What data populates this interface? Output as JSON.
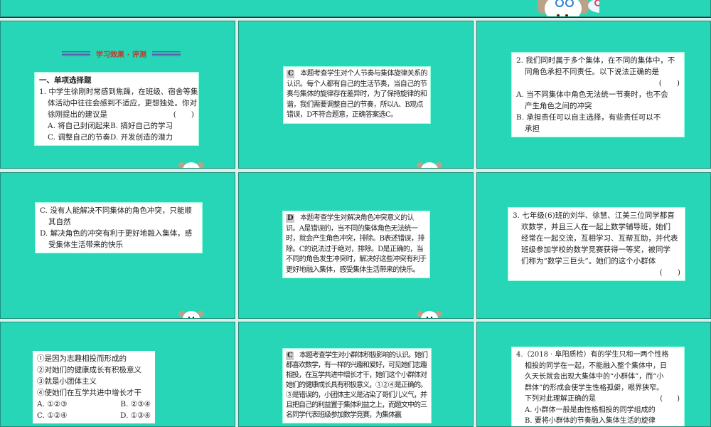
{
  "slide1": {
    "title": "学习效果 · 评测",
    "section": "一、单项选择题",
    "q1": [
      "1. 中学生徐刚时常感到焦躁，在班级、宿舍等集",
      "体活动中往往会感到不适应，更想独处。你对",
      "徐刚提出的建议是"
    ],
    "paren": "(　　)",
    "options": [
      "A. 将自己封闭起来",
      "B. 搞好自己的学习",
      "C. 调整自己的节奏",
      "D. 开发创造的潜力"
    ]
  },
  "slide2": {
    "tag": "C",
    "text": "本题考查学生对个人节奏与集体旋律关系的认识。每个人都有自己的生活节奏，当自己的节奏与集体的旋律存在差异时，为了保持旋律的和谐，我们需要调整自己的节奏，所以A、B观点错误，D不符合题意，正确答案选C。"
  },
  "slide3": {
    "q2": [
      "2. 我们同时属于多个集体，在不同的集体中，不",
      "同角色承担不同责任。以下说法正确的是"
    ],
    "paren": "(　　)",
    "optA": [
      "A. 当不同集体中角色无法统一节奏时，也不会",
      "产生角色之间的冲突"
    ],
    "optB": [
      "B. 承担责任可以自主选择，有些责任可以不",
      "承担"
    ]
  },
  "slide4": {
    "optC": [
      "C. 没有人能解决不同集体的角色冲突，只能顺",
      "其自然"
    ],
    "optD": [
      "D. 解决角色的冲突有利于更好地融入集体，感",
      "受集体生活带来的快乐"
    ]
  },
  "slide5": {
    "tag": "D",
    "text": "本题考查学生对解决角色冲突意义的认识。A是错误的，当不同的集体角色无法统一时，就会产生角色冲突，排除。B表述错误，排除。C的说法过于绝对，排除。D是正确的，当不同的角色发生冲突时，解决好这些冲突有利于更好地融入集体，感受集体生活带来的快乐。"
  },
  "slide6": {
    "q3": [
      "3. 七年级(6)班的刘华、徐慧、江美三位同学都喜",
      "欢数学，并且三人在一起上数学辅导班，她们",
      "经常在一起交流，互相学习、互帮互助，并代表",
      "班级参加学校的数学竞赛获得一等奖，被同学",
      "们称为“数学三巨头”。她们的这个小群体"
    ],
    "paren": "(　　)"
  },
  "slide7": {
    "items": [
      "①是因为志趣相投而形成的",
      "②对她们的健康成长有积极意义",
      "③就是小团体主义",
      "④使她们在互学共进中增长才干"
    ],
    "options": [
      "A. ①②③",
      "B. ②③④",
      "C. ①②④",
      "D. ①③④"
    ]
  },
  "slide8": {
    "tag": "C",
    "text": "本题考查学生对小群体积极影响的认识。她们都喜欢数学，有一样的兴趣和爱好，可见她们志趣相投，在互学共进中增长才干，她们这个小群体对她们的健康成长具有积极意义，①②④是正确的。③是错误的，小团体主义是沾染了哥们儿义气，并且把自己的利益置于集体利益之上，而题文中的三名同学代表班级参加数学竞赛，为集体赢"
  },
  "slide9": {
    "q4": [
      "4.（2018 · 阜阳质检）有的学生只和一两个性格",
      "相投的同学在一起，不能融入整个集体中，日",
      "久天长就会出现大集体中的“小群体”，而“小",
      "群体”的形成会使学生性格孤僻，眼界狭窄。",
      "下列对此理解正确的是"
    ],
    "paren": "(　　)",
    "optA": "A. 小群体一般是由性格相投的同学组成的",
    "optB": "B. 要将小群体的节奏融入集体生活的旋律"
  }
}
